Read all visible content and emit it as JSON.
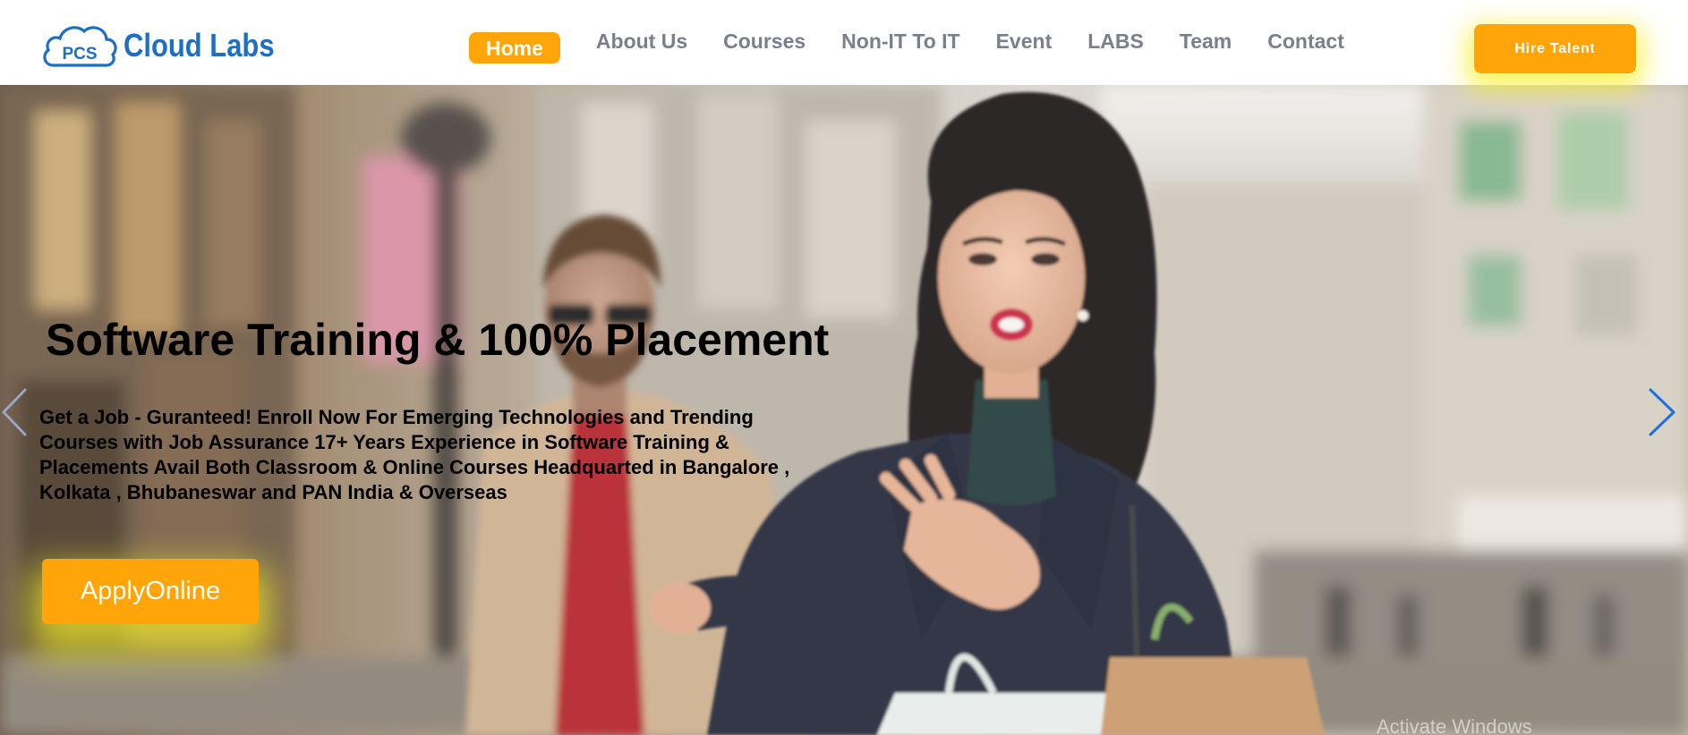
{
  "brand": {
    "logo_badge": "PCS",
    "logo_text": "Cloud Labs",
    "logo_color": "#1c6fc4"
  },
  "nav": {
    "items": [
      {
        "label": "Home",
        "active": true
      },
      {
        "label": "About Us",
        "active": false
      },
      {
        "label": "Courses",
        "active": false
      },
      {
        "label": "Non-IT To IT",
        "active": false
      },
      {
        "label": "Event",
        "active": false
      },
      {
        "label": "LABS",
        "active": false
      },
      {
        "label": "Team",
        "active": false
      },
      {
        "label": "Contact",
        "active": false
      }
    ],
    "hire_label": "Hire Talent"
  },
  "hero": {
    "title": "Software Training & 100% Placement",
    "description": "Get a Job - Guranteed! Enroll Now For Emerging Technologies and Trending Courses with Job Assurance 17+ Years Experience in Software Training & Placements Avail Both Classroom & Online Courses Headquarted in Bangalore , Kolkata , Bhubaneswar and PAN India & Overseas",
    "cta_label": "ApplyOnline",
    "prev_icon": "chevron-left-icon",
    "next_icon": "chevron-right-icon"
  },
  "overlay": {
    "watermark": "Activate Windows"
  },
  "colors": {
    "accent": "#ffa50a",
    "glow": "#f6f028",
    "nav_text": "#7a7f8c",
    "arrow": "#1f6fe0"
  }
}
